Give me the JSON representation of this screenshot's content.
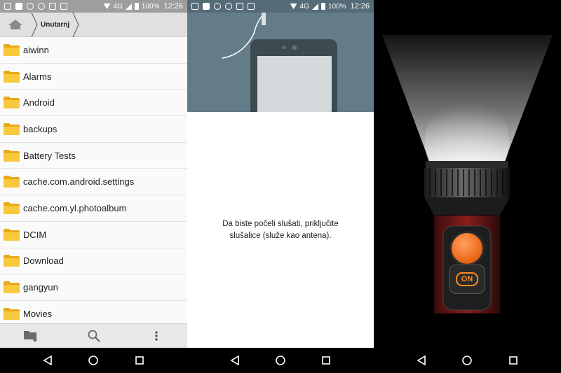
{
  "status": {
    "network": "4G",
    "battery": "100%",
    "time": "12:26"
  },
  "file_manager": {
    "breadcrumb": {
      "current": "Unutarnj"
    },
    "files": [
      {
        "name": "aiwinn"
      },
      {
        "name": "Alarms"
      },
      {
        "name": "Android"
      },
      {
        "name": "backups"
      },
      {
        "name": "Battery Tests"
      },
      {
        "name": "cache.com.android.settings"
      },
      {
        "name": "cache.com.yl.photoalbum"
      },
      {
        "name": "DCIM"
      },
      {
        "name": "Download"
      },
      {
        "name": "gangyun"
      },
      {
        "name": "Movies"
      }
    ],
    "toolbar_icons": [
      "new-folder-icon",
      "search-icon",
      "overflow-menu-icon"
    ]
  },
  "radio": {
    "message": "Da biste počeli slušati, priključite slušalice (služe kao antena)."
  },
  "flashlight": {
    "button_label": "ON",
    "accent_color": "#ff8c1a"
  },
  "colors": {
    "file_status_bar": "#9e9e9e",
    "radio_status_bar": "#556c78",
    "radio_hero": "#637c88",
    "folder": "#f5c136"
  }
}
